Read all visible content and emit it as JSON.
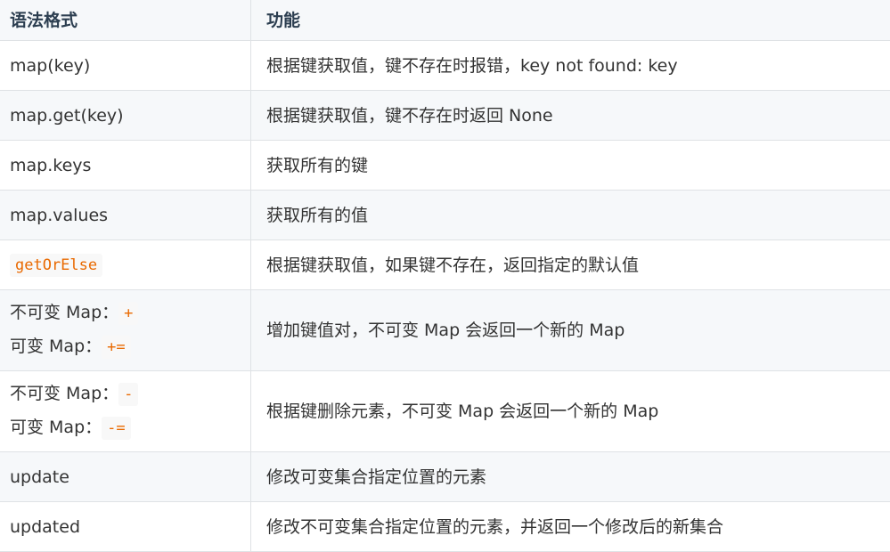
{
  "header": {
    "col1": "语法格式",
    "col2": "功能"
  },
  "rows": [
    {
      "syntax": "map(key)",
      "desc": "根据键获取值，键不存在时报错，key not found: key"
    },
    {
      "syntax": "map.get(key)",
      "desc": "根据键获取值，键不存在时返回 None"
    },
    {
      "syntax": "map.keys",
      "desc": "获取所有的键"
    },
    {
      "syntax": "map.values",
      "desc": "获取所有的值"
    },
    {
      "syntax_code": "getOrElse",
      "desc": "根据键获取值，如果键不存在，返回指定的默认值"
    },
    {
      "line1_label": "不可变 Map：",
      "line1_code": "+",
      "line2_label": "可变 Map：",
      "line2_code": "+=",
      "desc": "增加键值对，不可变 Map 会返回一个新的 Map"
    },
    {
      "line1_label": "不可变 Map：",
      "line1_code": "-",
      "line2_label": "可变 Map：",
      "line2_code": "-=",
      "desc": "根据键删除元素，不可变 Map 会返回一个新的 Map"
    },
    {
      "syntax": "update",
      "desc": "修改可变集合指定位置的元素"
    },
    {
      "syntax": "updated",
      "desc": "修改不可变集合指定位置的元素，并返回一个修改后的新集合"
    }
  ]
}
